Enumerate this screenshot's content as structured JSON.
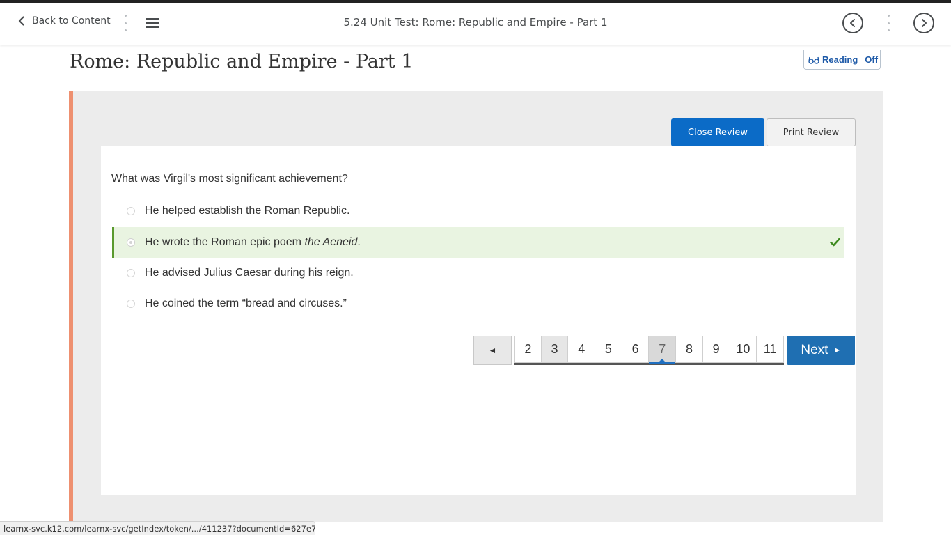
{
  "topbar": {
    "back_label": "Back to Content",
    "title": "5.24 Unit Test: Rome: Republic and Empire - Part 1"
  },
  "page": {
    "heading": "Rome: Republic and Empire - Part 1",
    "reading_label": "Reading",
    "reading_state": "Off"
  },
  "review": {
    "close_label": "Close Review",
    "print_label": "Print Review"
  },
  "question": {
    "text": "What was Virgil's most significant achievement?",
    "options": [
      {
        "text": "He helped establish the Roman Republic.",
        "correct": false
      },
      {
        "text_before": "He wrote the Roman epic poem ",
        "text_italic": "the Aeneid",
        "text_after": ".",
        "correct": true
      },
      {
        "text": "He advised Julius Caesar during his reign.",
        "correct": false
      },
      {
        "text": "He coined the term “bread and circuses.”",
        "correct": false
      }
    ]
  },
  "pager": {
    "prev_label": "◄",
    "pages": [
      "2",
      "3",
      "4",
      "5",
      "6",
      "7",
      "8",
      "9",
      "10",
      "11"
    ],
    "visited_page": "3",
    "current_page": "7",
    "next_label": "Next",
    "next_arrow": "►"
  },
  "status_bar": {
    "url": "learnx-svc.k12.com/learnx-svc/getIndex/token/.../411237?documentId=627e797..."
  },
  "colors": {
    "primary_blue": "#0b6bc7",
    "correct_green": "#5a9a2e",
    "panel_accent": "#ee9070"
  },
  "icons": {
    "back": "chevron-left-icon",
    "menu": "hamburger-menu-icon",
    "prev": "circle-chevron-left-icon",
    "next": "circle-chevron-right-icon",
    "reading": "reading-glasses-icon",
    "correct": "checkmark-icon"
  }
}
